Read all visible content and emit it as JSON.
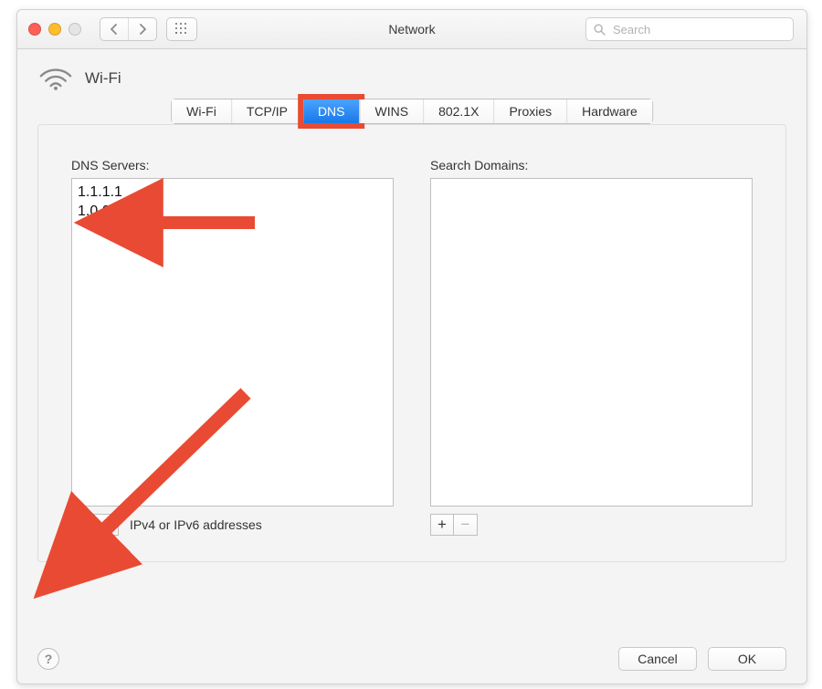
{
  "window": {
    "title": "Network"
  },
  "toolbar": {
    "search_placeholder": "Search"
  },
  "service": {
    "name": "Wi-Fi"
  },
  "tabs": [
    {
      "label": "Wi-Fi",
      "selected": false
    },
    {
      "label": "TCP/IP",
      "selected": false
    },
    {
      "label": "DNS",
      "selected": true
    },
    {
      "label": "WINS",
      "selected": false
    },
    {
      "label": "802.1X",
      "selected": false
    },
    {
      "label": "Proxies",
      "selected": false
    },
    {
      "label": "Hardware",
      "selected": false
    }
  ],
  "dns": {
    "servers_label": "DNS Servers:",
    "servers": [
      "1.1.1.1",
      "1.0.0.1"
    ],
    "domains_label": "Search Domains:",
    "domains": [],
    "hint": "IPv4 or IPv6 addresses"
  },
  "footer": {
    "cancel": "Cancel",
    "ok": "OK"
  },
  "annotation": {
    "highlighted_tab": "DNS",
    "color": "#e94a33"
  }
}
